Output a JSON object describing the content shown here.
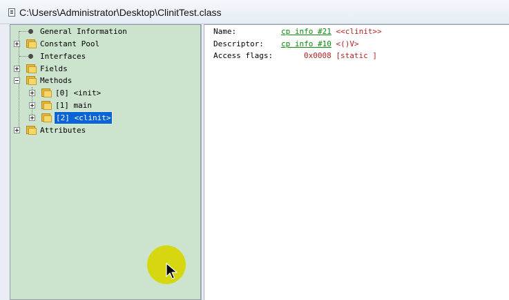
{
  "window": {
    "title": "C:\\Users\\Administrator\\Desktop\\ClinitTest.class"
  },
  "tree": {
    "items": [
      {
        "label": "General Information",
        "kind": "leaf"
      },
      {
        "label": "Constant Pool",
        "kind": "folder"
      },
      {
        "label": "Interfaces",
        "kind": "leaf"
      },
      {
        "label": "Fields",
        "kind": "folder"
      },
      {
        "label": "Methods",
        "kind": "folder-open"
      },
      {
        "label": "[0] <init>",
        "kind": "folder"
      },
      {
        "label": "[1] main",
        "kind": "folder"
      },
      {
        "label": "[2] <clinit>",
        "kind": "folder",
        "selected": true
      },
      {
        "label": "Attributes",
        "kind": "folder"
      }
    ]
  },
  "details": {
    "name": {
      "key": "Name:",
      "link": "cp info #21",
      "value": "<<clinit>>"
    },
    "descriptor": {
      "key": "Descriptor:",
      "link": "cp info #10",
      "value": "<()V>"
    },
    "access_flags": {
      "key": "Access flags:",
      "value": "0x0008 [static ]"
    }
  },
  "colors": {
    "tree_background": "#cce3ce",
    "selection": "#0a64d6",
    "link_green": "#0a8a0a",
    "value_red": "#b22222",
    "cursor_highlight": "#d7d600"
  }
}
